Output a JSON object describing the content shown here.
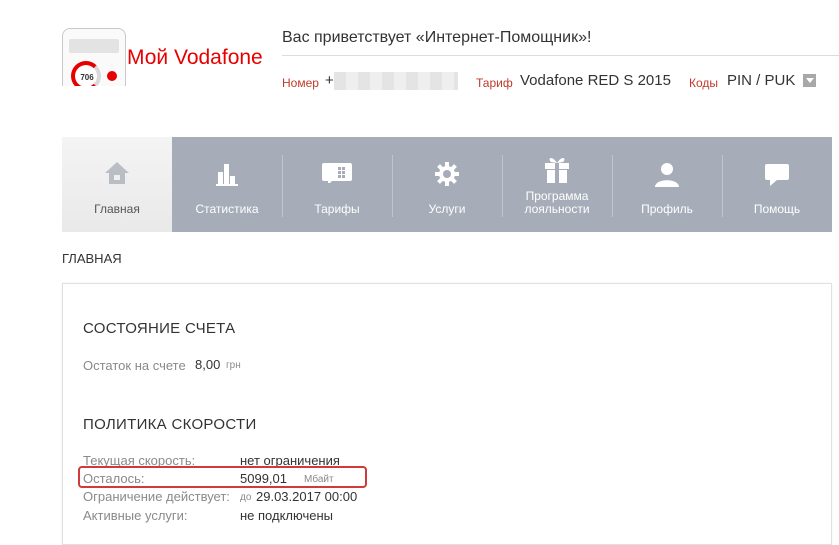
{
  "header": {
    "logo_text": "Мой Vodafone",
    "phone_widget_value": "706",
    "welcome": "Вас приветствует «Интернет-Помощник»!",
    "number_label": "Номер",
    "number_prefix": "+",
    "tariff_label": "Тариф",
    "tariff_value": "Vodafone RED S 2015",
    "codes_label": "Коды",
    "codes_value": "PIN / PUK"
  },
  "nav": {
    "items": [
      {
        "label": "Главная",
        "icon": "home-icon",
        "active": true
      },
      {
        "label": "Статистика",
        "icon": "bar-chart-icon"
      },
      {
        "label": "Тарифы",
        "icon": "tariff-card-icon"
      },
      {
        "label": "Услуги",
        "icon": "gear-icon"
      },
      {
        "label": "Программа\nлояльности",
        "icon": "gift-icon"
      },
      {
        "label": "Профиль",
        "icon": "user-icon"
      },
      {
        "label": "Помощь",
        "icon": "speech-bubble-icon"
      }
    ]
  },
  "breadcrumb": "ГЛАВНАЯ",
  "account": {
    "title": "СОСТОЯНИЕ СЧЕТА",
    "balance_label": "Остаток на счете",
    "balance_value": "8,00",
    "balance_unit": "грн"
  },
  "speed": {
    "title": "ПОЛИТИКА СКОРОСТИ",
    "current_label": "Текущая скорость:",
    "current_value": "нет ограничения",
    "remaining_label": "Осталось:",
    "remaining_value": "5099,01",
    "remaining_unit": "Мбайт",
    "until_label": "Ограничение действует:",
    "until_prefix": "до",
    "until_value": "29.03.2017 00:00",
    "services_label": "Активные услуги:",
    "services_value": "не подключены"
  },
  "colors": {
    "brand": "#e60000",
    "nav_bg": "#a6adb8",
    "highlight_border": "#d03a3a"
  }
}
